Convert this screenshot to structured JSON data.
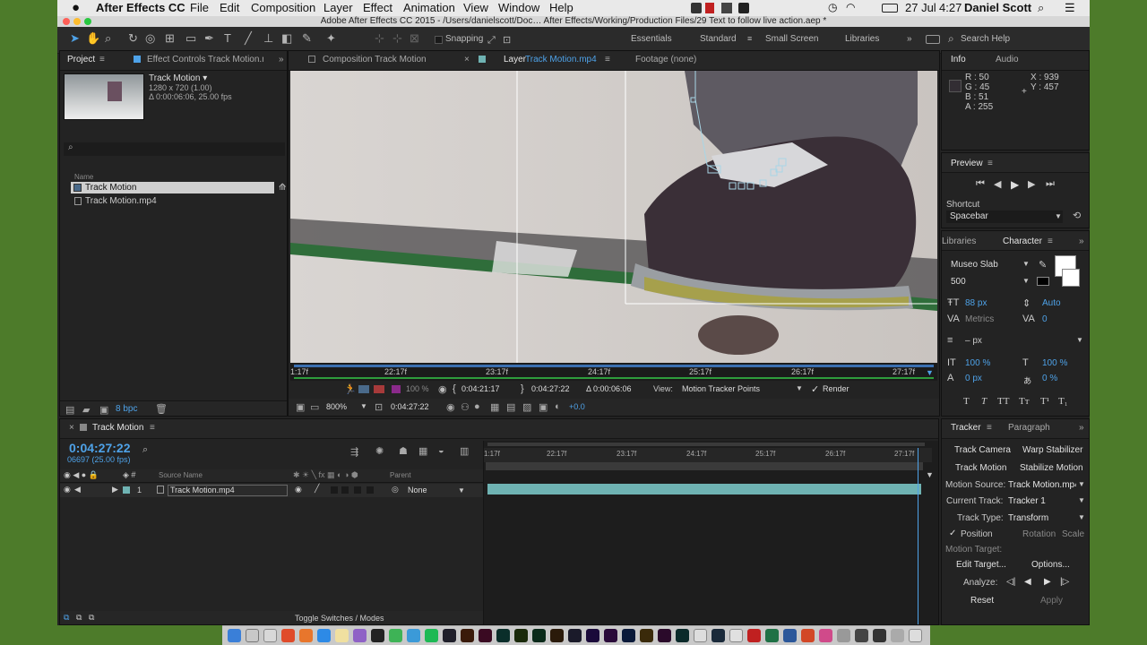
{
  "menubar": {
    "app": "After Effects CC",
    "items": [
      "File",
      "Edit",
      "Composition",
      "Layer",
      "Effect",
      "Animation",
      "View",
      "Window",
      "Help"
    ],
    "date": "27 Jul",
    "time": "4:27",
    "user": "Daniel Scott"
  },
  "window": {
    "title": "Adobe After Effects CC 2015 - /Users/danielscott/Doc… After Effects/Working/Production Files/29 Text to follow live action.aep *"
  },
  "toolbar": {
    "snapping": "Snapping",
    "workspaces": [
      "Essentials",
      "Standard",
      "Small Screen",
      "Libraries"
    ],
    "active_workspace": "Standard",
    "search_placeholder": "Search Help"
  },
  "project": {
    "tab": "Project",
    "tab2": "Effect Controls Track Motion.mp4",
    "comp_name": "Track Motion ▾",
    "comp_size": "1280 x 720 (1.00)",
    "comp_duration": "Δ 0:00:06:06, 25.00 fps",
    "search_placeholder": "",
    "col_name": "Name",
    "items": [
      {
        "name": "Track Motion",
        "type": "comp"
      },
      {
        "name": "Track Motion.mp4",
        "type": "footage"
      }
    ],
    "bpc": "8 bpc"
  },
  "viewer": {
    "tabs": [
      "Composition Track Motion",
      "Layer Track Motion.mp4",
      "Footage (none)"
    ],
    "layer_label": "Layer",
    "layer_name": "Track Motion.mp4",
    "ruler": [
      "1:17f",
      "22:17f",
      "23:17f",
      "24:17f",
      "25:17f",
      "26:17f",
      "27:17f"
    ],
    "opacity": "100 %",
    "in_point": "0:04:21:17",
    "out_point": "0:04:27:22",
    "duration": "Δ 0:00:06:06",
    "view_label": "View:",
    "view_value": "Motion Tracker Points",
    "render_label": "Render",
    "render_checked": true,
    "zoom": "800%",
    "timecode": "0:04:27:22",
    "exposure": "+0.0"
  },
  "info": {
    "tab": "Info",
    "tab2": "Audio",
    "r": "R : 50",
    "g": "G : 45",
    "b": "B : 51",
    "a": "A : 255",
    "x": "X : 939",
    "y": "Y : 457",
    "swatch": "#322d33"
  },
  "preview": {
    "tab": "Preview",
    "shortcut_label": "Shortcut",
    "shortcut_value": "Spacebar"
  },
  "character": {
    "tab": "Libraries",
    "tab2": "Character",
    "font": "Museo Slab",
    "weight": "500",
    "size": "88 px",
    "leading": "Auto",
    "kerning": "Metrics",
    "tracking": "0",
    "stroke": "– px",
    "vscale": "100 %",
    "hscale": "100 %",
    "baseline": "0 px",
    "tsume": "0 %",
    "styles": [
      "T",
      "T",
      "TT",
      "Tт",
      "T¹",
      "T₁"
    ]
  },
  "timeline": {
    "tab": "Track Motion",
    "timecode": "0:04:27:22",
    "frames": "06697 (25.00 fps)",
    "search_placeholder": "",
    "col_source": "Source Name",
    "col_parent": "Parent",
    "layer_num": "1",
    "layer_name": "Track Motion.mp4",
    "parent_value": "None",
    "ruler": [
      "1:17f",
      "22:17f",
      "23:17f",
      "24:17f",
      "25:17f",
      "26:17f",
      "27:17f"
    ],
    "toggle": "Toggle Switches / Modes"
  },
  "tracker": {
    "tab": "Tracker",
    "tab2": "Paragraph",
    "track_camera": "Track Camera",
    "warp_stabilizer": "Warp Stabilizer",
    "track_motion": "Track Motion",
    "stabilize_motion": "Stabilize Motion",
    "motion_source_label": "Motion Source:",
    "motion_source": "Track Motion.mp4",
    "current_track_label": "Current Track:",
    "current_track": "Tracker 1",
    "track_type_label": "Track Type:",
    "track_type": "Transform",
    "position": "Position",
    "position_checked": true,
    "rotation": "Rotation",
    "scale": "Scale",
    "motion_target": "Motion Target:",
    "edit_target": "Edit Target...",
    "options": "Options...",
    "analyze": "Analyze:",
    "reset": "Reset",
    "apply": "Apply"
  },
  "colors": {
    "accent": "#4ea2e8",
    "panel": "#232323",
    "track": "#2e9c3c",
    "layer_bar": "#6fb3b3"
  }
}
